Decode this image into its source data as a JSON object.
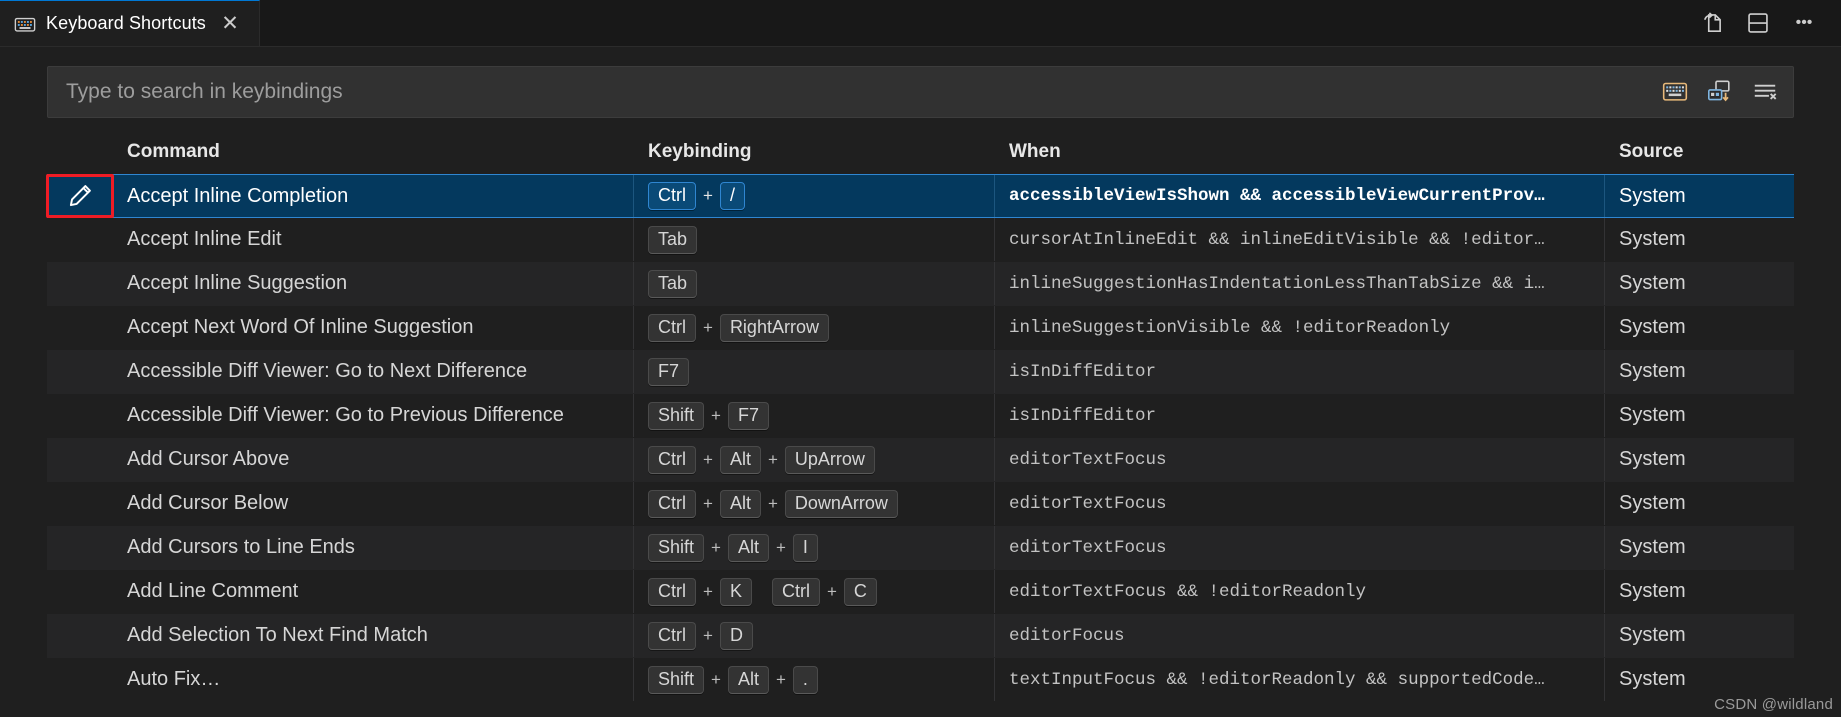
{
  "tab": {
    "title": "Keyboard Shortcuts",
    "icon": "keyboard-icon",
    "close_label": "✕"
  },
  "titlebar_actions": [
    {
      "name": "open-changes-icon",
      "label": "Open Changes"
    },
    {
      "name": "split-editor-down-icon",
      "label": "Split Editor Down"
    },
    {
      "name": "more-actions-icon",
      "label": "•••"
    }
  ],
  "search": {
    "placeholder": "Type to search in keybindings",
    "value": "",
    "actions": [
      {
        "name": "record-keys-icon",
        "label": "Record Keys"
      },
      {
        "name": "sort-by-precedence-icon",
        "label": "Sort by Precedence"
      },
      {
        "name": "clear-keybindings-search-icon",
        "label": "Clear Keybindings Search Input"
      }
    ]
  },
  "table": {
    "columns": {
      "icon": "",
      "command": "Command",
      "keybinding": "Keybinding",
      "when": "When",
      "source": "Source"
    },
    "rows": [
      {
        "selected": true,
        "edit_icon": "pencil-icon",
        "command": "Accept Inline Completion",
        "chords": [
          [
            "Ctrl",
            "/"
          ]
        ],
        "when": "accessibleViewIsShown && accessibleViewCurrentProv…",
        "source": "System"
      },
      {
        "selected": false,
        "command": "Accept Inline Edit",
        "chords": [
          [
            "Tab"
          ]
        ],
        "when": "cursorAtInlineEdit && inlineEditVisible && !editor…",
        "source": "System"
      },
      {
        "selected": false,
        "command": "Accept Inline Suggestion",
        "chords": [
          [
            "Tab"
          ]
        ],
        "when": "inlineSuggestionHasIndentationLessThanTabSize && i…",
        "source": "System"
      },
      {
        "selected": false,
        "command": "Accept Next Word Of Inline Suggestion",
        "chords": [
          [
            "Ctrl",
            "RightArrow"
          ]
        ],
        "when": "inlineSuggestionVisible && !editorReadonly",
        "source": "System"
      },
      {
        "selected": false,
        "command": "Accessible Diff Viewer: Go to Next Difference",
        "chords": [
          [
            "F7"
          ]
        ],
        "when": "isInDiffEditor",
        "source": "System"
      },
      {
        "selected": false,
        "command": "Accessible Diff Viewer: Go to Previous Difference",
        "chords": [
          [
            "Shift",
            "F7"
          ]
        ],
        "when": "isInDiffEditor",
        "source": "System"
      },
      {
        "selected": false,
        "command": "Add Cursor Above",
        "chords": [
          [
            "Ctrl",
            "Alt",
            "UpArrow"
          ]
        ],
        "when": "editorTextFocus",
        "source": "System"
      },
      {
        "selected": false,
        "command": "Add Cursor Below",
        "chords": [
          [
            "Ctrl",
            "Alt",
            "DownArrow"
          ]
        ],
        "when": "editorTextFocus",
        "source": "System"
      },
      {
        "selected": false,
        "command": "Add Cursors to Line Ends",
        "chords": [
          [
            "Shift",
            "Alt",
            "I"
          ]
        ],
        "when": "editorTextFocus",
        "source": "System"
      },
      {
        "selected": false,
        "command": "Add Line Comment",
        "chords": [
          [
            "Ctrl",
            "K"
          ],
          [
            "Ctrl",
            "C"
          ]
        ],
        "when": "editorTextFocus && !editorReadonly",
        "source": "System"
      },
      {
        "selected": false,
        "command": "Add Selection To Next Find Match",
        "chords": [
          [
            "Ctrl",
            "D"
          ]
        ],
        "when": "editorFocus",
        "source": "System"
      },
      {
        "selected": false,
        "command": "Auto Fix…",
        "chords": [
          [
            "Shift",
            "Alt",
            "."
          ]
        ],
        "when": "textInputFocus && !editorReadonly && supportedCode…",
        "source": "System"
      }
    ]
  },
  "annotation": {
    "color": "#ee1c25"
  },
  "watermark": "CSDN @wildland",
  "colors": {
    "background": "#1f1f1f",
    "row_alt": "#252526",
    "selection": "#04395e",
    "selection_border": "#2f86d1",
    "accent": "#0078d4",
    "text": "#cccccc"
  }
}
